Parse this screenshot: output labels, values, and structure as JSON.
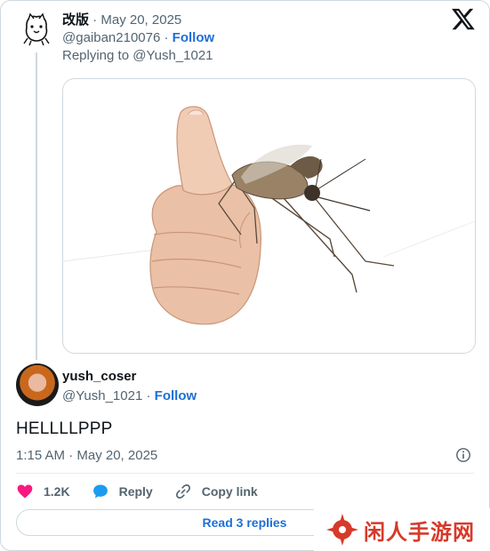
{
  "quoted_tweet": {
    "display_name": "改版",
    "separator": " · ",
    "date": "May 20, 2025",
    "handle": "@gaiban210076",
    "follow_sep": " · ",
    "follow_label": "Follow",
    "replying_to": "Replying to @Yush_1021"
  },
  "main_tweet": {
    "display_name": "yush_coser",
    "handle": "@Yush_1021",
    "follow_sep": " · ",
    "follow_label": "Follow",
    "text": "HELLLLPPP",
    "timestamp": "1:15 AM · May 20, 2025"
  },
  "actions": {
    "like_count": "1.2K",
    "reply_label": "Reply",
    "copy_label": "Copy link"
  },
  "read_replies_label": "Read 3 replies",
  "watermark_text": "闲人手游网",
  "colors": {
    "link": "#1d6fd8",
    "like": "#f91880",
    "reply_bubble": "#1d9bf0",
    "muted": "#536471",
    "border": "#cfd9de",
    "watermark": "#d63a2a"
  }
}
